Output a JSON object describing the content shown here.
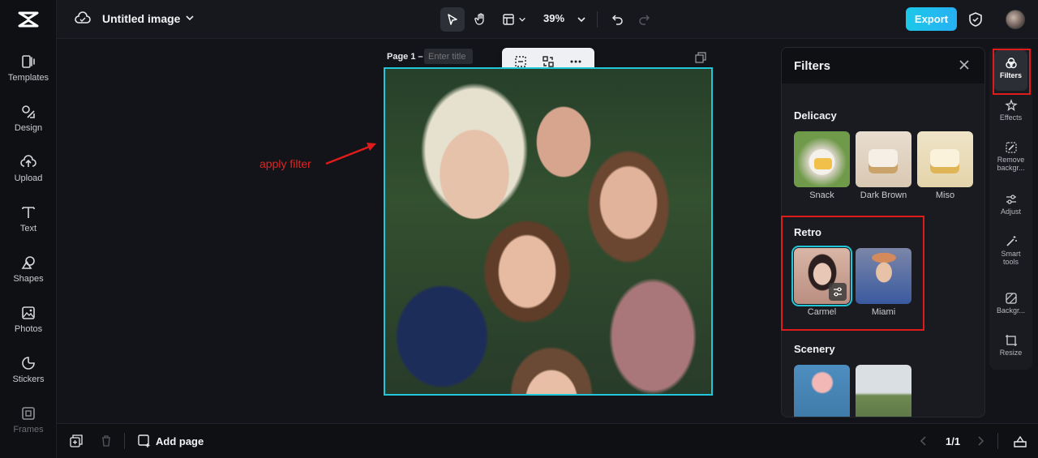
{
  "topbar": {
    "document_title": "Untitled image",
    "zoom": "39%",
    "export_label": "Export"
  },
  "leftbar": {
    "items": [
      {
        "label": "Templates",
        "icon": "templates-icon"
      },
      {
        "label": "Design",
        "icon": "design-icon"
      },
      {
        "label": "Upload",
        "icon": "upload-icon"
      },
      {
        "label": "Text",
        "icon": "text-icon"
      },
      {
        "label": "Shapes",
        "icon": "shapes-icon"
      },
      {
        "label": "Photos",
        "icon": "photos-icon"
      },
      {
        "label": "Stickers",
        "icon": "stickers-icon"
      },
      {
        "label": "Frames",
        "icon": "frames-icon"
      }
    ]
  },
  "canvas": {
    "page_label": "Page 1 –",
    "title_placeholder": "Enter title",
    "annotation": "apply filter"
  },
  "filters_panel": {
    "title": "Filters",
    "sections": [
      {
        "title": "Delicacy",
        "items": [
          {
            "label": "Snack",
            "colors": [
              "#f4f1ea",
              "#6f9a4a"
            ]
          },
          {
            "label": "Dark Brown",
            "colors": [
              "#e8ddd0",
              "#caa36a"
            ]
          },
          {
            "label": "Miso",
            "colors": [
              "#efe4c8",
              "#e0b555"
            ]
          }
        ]
      },
      {
        "title": "Retro",
        "items": [
          {
            "label": "Carmel",
            "colors": [
              "#caa596",
              "#3a2a28"
            ],
            "selected": true
          },
          {
            "label": "Miami",
            "colors": [
              "#3a5aa0",
              "#d48a5a"
            ]
          }
        ]
      },
      {
        "title": "Scenery",
        "items": [
          {
            "label": "",
            "colors": [
              "#4d8ec0",
              "#e7a6a6"
            ]
          },
          {
            "label": "",
            "colors": [
              "#d9dfe2",
              "#6f8a53"
            ]
          }
        ]
      }
    ]
  },
  "rightbar": {
    "items": [
      {
        "label": "Filters",
        "icon": "filters-icon",
        "active": true
      },
      {
        "label": "Effects",
        "icon": "effects-icon"
      },
      {
        "label": "Remove backgr...",
        "icon": "remove-background-icon"
      },
      {
        "label": "Adjust",
        "icon": "adjust-icon"
      },
      {
        "label": "Smart tools",
        "icon": "smart-tools-icon"
      },
      {
        "label": "Backgr...",
        "icon": "background-icon"
      },
      {
        "label": "Resize",
        "icon": "resize-icon"
      }
    ]
  },
  "bottombar": {
    "add_page_label": "Add page",
    "page_indicator": "1/1"
  },
  "colors": {
    "accent": "#22c6d9",
    "annotation_red": "#e01b1b",
    "export_gradient": [
      "#1cc8e8",
      "#27b0f5"
    ]
  }
}
